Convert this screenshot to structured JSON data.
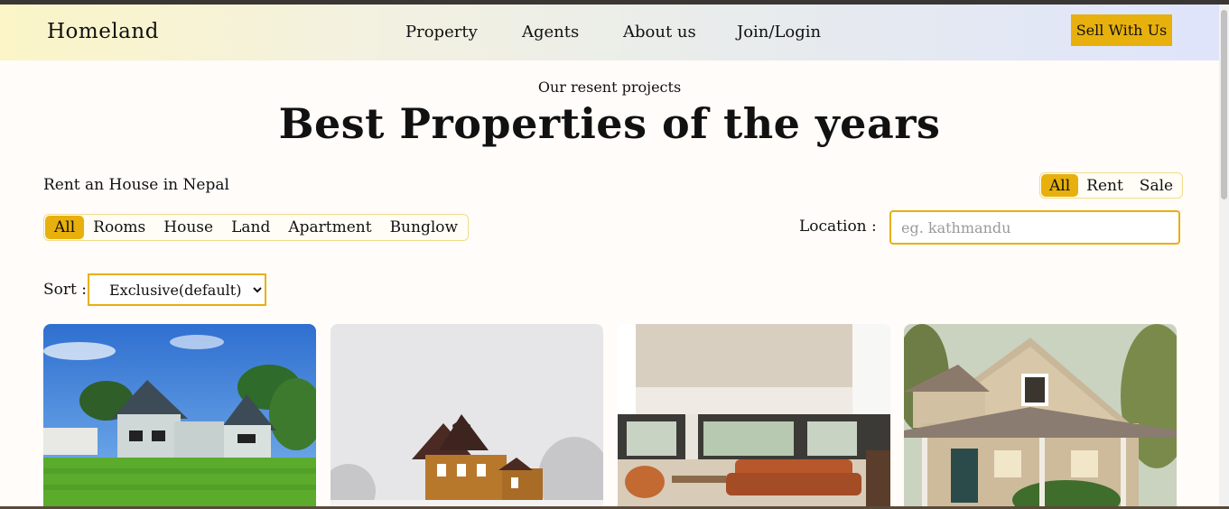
{
  "header": {
    "brand": "Homeland",
    "nav": [
      "Property",
      "Agents",
      "About us",
      "Join/Login"
    ],
    "cta": "Sell With Us"
  },
  "hero": {
    "subtitle": "Our resent projects",
    "title": "Best Properties of the years"
  },
  "filters": {
    "rent_label": "Rent an House in Nepal",
    "listing_types": [
      "All",
      "Rent",
      "Sale"
    ],
    "listing_active": "All",
    "property_types": [
      "All",
      "Rooms",
      "House",
      "Land",
      "Apartment",
      "Bunglow"
    ],
    "property_active": "All",
    "location_label": "Location :",
    "location_placeholder": "eg. kathmandu",
    "location_value": "",
    "sort_label": "Sort :",
    "sort_selected": "Exclusive(default)"
  },
  "cards": [
    {
      "image": "modern-white-house-on-green-lawn"
    },
    {
      "image": "victorian-house-in-snowy-trees"
    },
    {
      "image": "modern-living-room-interior"
    },
    {
      "image": "suburban-beige-house-with-porch"
    }
  ],
  "colors": {
    "accent": "#e7b00c",
    "page_background": "#fffcf9"
  }
}
